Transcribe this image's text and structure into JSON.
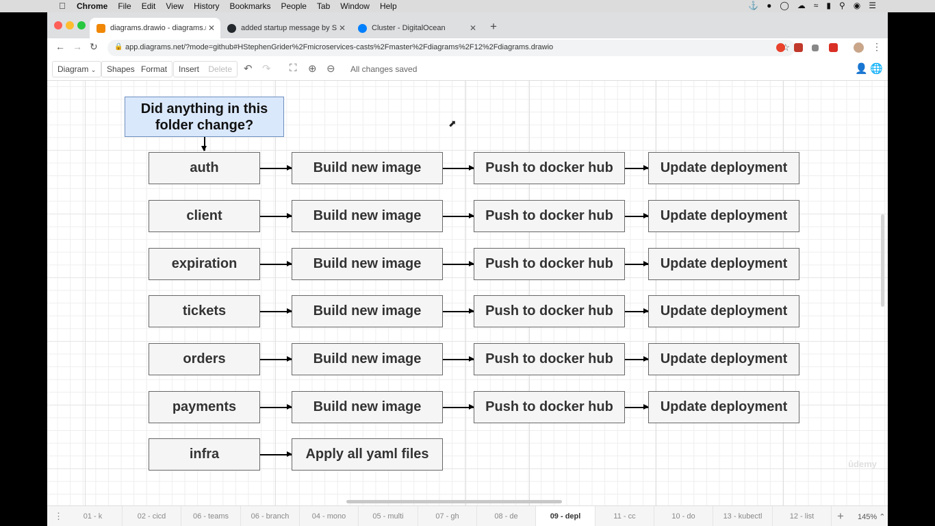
{
  "menubar": {
    "apple": "",
    "items": [
      "Chrome",
      "File",
      "Edit",
      "View",
      "History",
      "Bookmarks",
      "People",
      "Tab",
      "Window",
      "Help"
    ]
  },
  "browser": {
    "tabs": [
      {
        "title": "diagrams.drawio - diagrams.net",
        "icon_color": "#f08705",
        "active": true
      },
      {
        "title": "added startup message by Stephen",
        "icon_color": "#24292e",
        "active": false
      },
      {
        "title": "Cluster - DigitalOcean",
        "icon_color": "#0080ff",
        "active": false
      }
    ],
    "new_tab": "+",
    "url": "app.diagrams.net/?mode=github#HStephenGrider%2Fmicroservices-casts%2Fmaster%2Fdiagrams%2F12%2Fdiagrams.drawio"
  },
  "drawio": {
    "menu_diagram": "Diagram",
    "menu_shapes": "Shapes",
    "menu_format": "Format",
    "menu_insert": "Insert",
    "menu_delete": "Delete",
    "status": "All changes saved"
  },
  "diagram": {
    "question": "Did anything in this folder change?",
    "steps": {
      "build": "Build new image",
      "push": "Push to docker hub",
      "update": "Update deployment",
      "apply": "Apply all yaml files"
    },
    "services": [
      "auth",
      "client",
      "expiration",
      "tickets",
      "orders",
      "payments"
    ],
    "infra": "infra"
  },
  "watermark": "ûdemy",
  "pages": {
    "tabs": [
      "01 - k",
      "02 - cicd",
      "06 - teams",
      "06 - branch",
      "04 - mono",
      "05 - multi",
      "07 - gh",
      "08 - de",
      "09 - depl",
      "11 - cc",
      "10 - do",
      "13 - kubectl",
      "12 - list"
    ],
    "active": "09 - depl",
    "add": "+",
    "zoom": "145%"
  }
}
